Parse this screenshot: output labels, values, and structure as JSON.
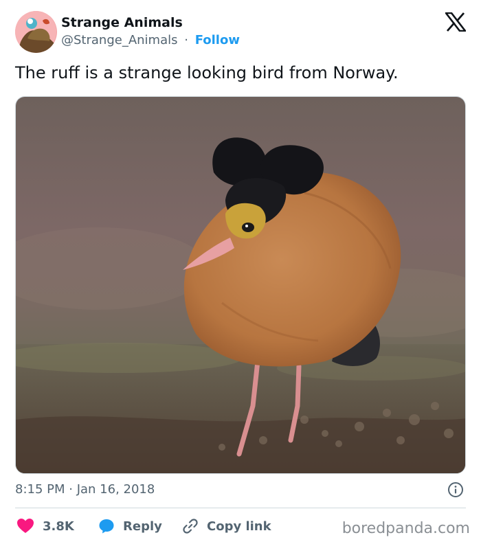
{
  "author": {
    "name": "Strange Animals",
    "handle": "@Strange_Animals",
    "separator": "·",
    "follow_label": "Follow",
    "avatar_icon": "avatar-image"
  },
  "platform": {
    "icon": "x-logo-icon"
  },
  "tweet": {
    "text": "The ruff is a strange looking bird from Norway.",
    "media_description_icon": "ruff-bird-photo",
    "timestamp": "8:15 PM · Jan 16, 2018"
  },
  "actions": {
    "like_count": "3.8K",
    "reply_label": "Reply",
    "copy_label": "Copy link"
  },
  "watermark": "boredpanda.com",
  "colors": {
    "accent": "#1d9bf0",
    "like": "#f91880",
    "text_primary": "#0f1419",
    "text_secondary": "#536471",
    "border": "#cfd9de"
  }
}
